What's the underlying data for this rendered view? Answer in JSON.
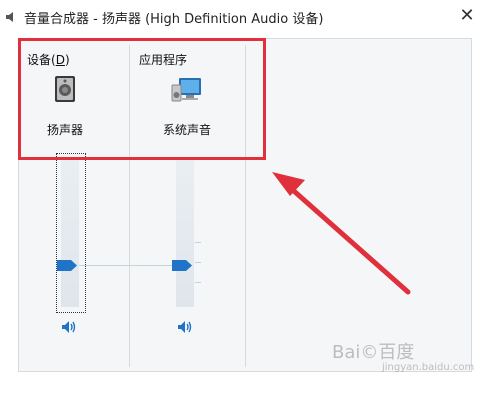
{
  "window": {
    "title": "音量合成器 - 扬声器 (High Definition Audio 设备)",
    "close_symbol": "✕"
  },
  "sections": {
    "device_label": "设备(",
    "device_mnemonic": "D",
    "device_label_end": ")",
    "apps_label": "应用程序"
  },
  "channels": [
    {
      "name": "扬声器",
      "icon": "speaker-device-icon",
      "volume_level": 0.28,
      "mute_icon": "speaker-volume-icon"
    },
    {
      "name": "系统声音",
      "icon": "system-sounds-icon",
      "volume_level": 0.28,
      "mute_icon": "speaker-volume-icon"
    }
  ],
  "annotation": {
    "highlight_color": "#e0303b",
    "arrow_color": "#e0303b"
  },
  "watermark": {
    "main": "Bai©百度",
    "sub": "jingyan.baidu.com"
  },
  "colors": {
    "thumb": "#1f73c8",
    "content_bg": "#f4f6f8"
  }
}
